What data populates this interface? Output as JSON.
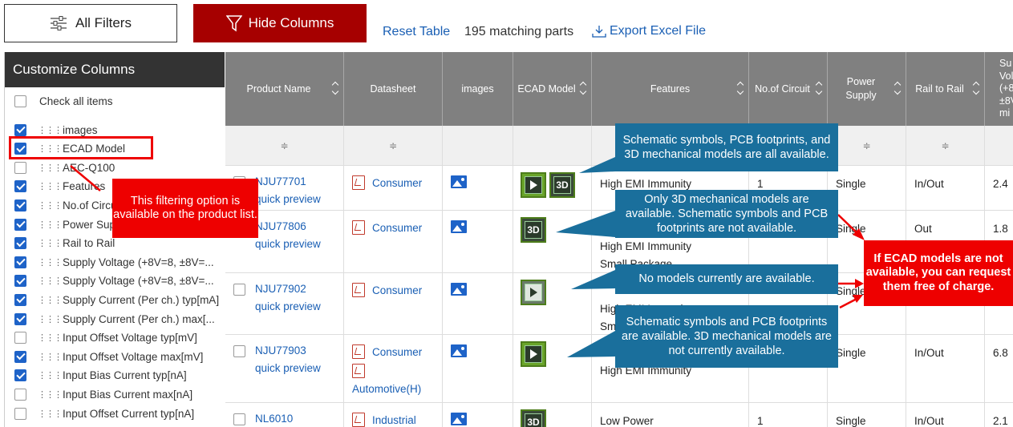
{
  "toolbar": {
    "all_filters": "All Filters",
    "hide_columns": "Hide Columns",
    "reset_table": "Reset Table",
    "matching": "195 matching parts",
    "export": "Export Excel File"
  },
  "panel": {
    "title": "Customize Columns",
    "check_all": "Check all items",
    "items": [
      {
        "label": "images",
        "checked": true
      },
      {
        "label": "ECAD Model",
        "checked": true
      },
      {
        "label": "AEC-Q100",
        "checked": false
      },
      {
        "label": "Features",
        "checked": true
      },
      {
        "label": "No.of Circuit",
        "checked": true
      },
      {
        "label": "Power Supply",
        "checked": true
      },
      {
        "label": "Rail to Rail",
        "checked": true
      },
      {
        "label": "Supply Voltage (+8V=8, ±8V=...",
        "checked": true
      },
      {
        "label": "Supply Voltage (+8V=8, ±8V=...",
        "checked": true
      },
      {
        "label": "Supply Current (Per ch.) typ[mA]",
        "checked": true
      },
      {
        "label": "Supply Current (Per ch.) max[...",
        "checked": true
      },
      {
        "label": "Input Offset Voltage typ[mV]",
        "checked": false
      },
      {
        "label": "Input Offset Voltage max[mV]",
        "checked": true
      },
      {
        "label": "Input Bias Current typ[nA]",
        "checked": true
      },
      {
        "label": "Input Bias Current max[nA]",
        "checked": false
      },
      {
        "label": "Input Offset Current typ[nA]",
        "checked": false
      }
    ]
  },
  "table": {
    "headers": {
      "product_name": "Product Name",
      "datasheet": "Datasheet",
      "images": "images",
      "ecad": "ECAD Model",
      "features": "Features",
      "circuits": "No.of Circuit",
      "power_line1": "Power",
      "power_line2": "Supply",
      "rail": "Rail to Rail",
      "supply_v1": "Su",
      "supply_v2": "Vol",
      "supply_v3": "(+8",
      "supply_v4": "±8V",
      "supply_v5": "mi"
    },
    "filter_glyph": "≑",
    "quick_preview": "quick preview",
    "rows": [
      {
        "name": "NJU77701",
        "ds": [
          "Consumer"
        ],
        "feature1": "High EMI Immunity",
        "feature2": "",
        "feature3": "",
        "circuit": "1",
        "power": "Single",
        "rail": "In/Out",
        "volt": "2.4"
      },
      {
        "name": "NJU77806",
        "ds": [
          "Consumer"
        ],
        "feature1": "",
        "feature2": "High EMI Immunity",
        "feature3": "Small Package",
        "circuit": "",
        "power": "Single",
        "rail": "Out",
        "volt": "1.8"
      },
      {
        "name": "NJU77902",
        "ds": [
          "Consumer"
        ],
        "feature1": "",
        "feature2": "High EMI Immunity",
        "feature3": "Sm",
        "circuit": "",
        "power": "Single",
        "rail": "",
        "volt": ""
      },
      {
        "name": "NJU77903",
        "ds": [
          "Consumer",
          "Automotive(H)"
        ],
        "feature1": "",
        "feature2": "High EMI Immunity",
        "feature3": "",
        "circuit": "",
        "power": "Single",
        "rail": "In/Out",
        "volt": "6.8"
      },
      {
        "name": "NL6010",
        "ds": [
          "Industrial"
        ],
        "feature1": "Low Power",
        "feature2": "",
        "feature3": "",
        "circuit": "1",
        "power": "Single",
        "rail": "In/Out",
        "volt": "2.1"
      }
    ]
  },
  "ecad_labels": {
    "d3": "3D"
  },
  "callouts": {
    "filtering": "This filtering option is available on the product list.",
    "all": "Schematic symbols, PCB footprints, and 3D mechanical models are all available.",
    "only3d": "Only 3D mechanical models are available. Schematic symbols and PCB footprints are not available.",
    "none": "No models currently are available.",
    "sym": "Schematic symbols and PCB footprints are available. 3D mechanical models are not currently available.",
    "request": "If ECAD models are not available, you can request them free of charge."
  },
  "colors": {
    "accent": "#a60000",
    "callout": "#1a6f9c",
    "alert": "#ee0000",
    "link": "#1a5fb4"
  }
}
